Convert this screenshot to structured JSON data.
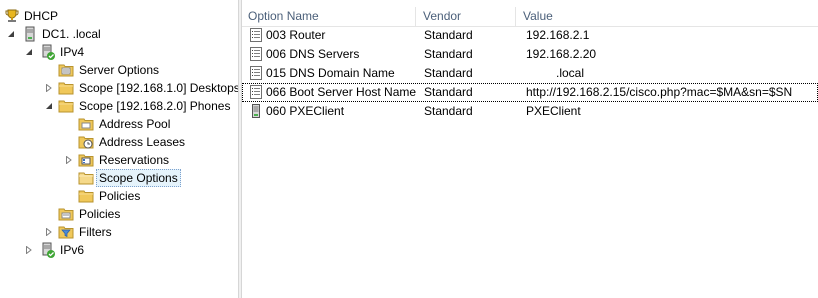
{
  "tree": {
    "root": {
      "label": "DHCP",
      "icon": "dhcp-icon"
    },
    "server": {
      "label": "DC1.        .local",
      "icon": "server-icon"
    },
    "ipv4": {
      "label": "IPv4",
      "icon": "ipv4-icon"
    },
    "server_options": {
      "label": "Server Options",
      "icon": "server-options-icon"
    },
    "scope1": {
      "label": "Scope [192.168.1.0] Desktops",
      "icon": "folder-icon"
    },
    "scope2": {
      "label": "Scope [192.168.2.0] Phones",
      "icon": "folder-icon"
    },
    "address_pool": {
      "label": "Address Pool",
      "icon": "address-pool-icon"
    },
    "address_leases": {
      "label": "Address Leases",
      "icon": "address-leases-icon"
    },
    "reservations": {
      "label": "Reservations",
      "icon": "reservations-icon"
    },
    "scope_options": {
      "label": "Scope Options",
      "icon": "scope-options-icon",
      "selected": true
    },
    "scope_policies": {
      "label": "Policies",
      "icon": "policies-icon"
    },
    "policies": {
      "label": "Policies",
      "icon": "policies-icon"
    },
    "filters": {
      "label": "Filters",
      "icon": "filter-icon"
    },
    "ipv6": {
      "label": "IPv6",
      "icon": "ipv6-icon"
    }
  },
  "list": {
    "columns": {
      "option_name": "Option Name",
      "vendor": "Vendor",
      "value": "Value"
    },
    "rows": [
      {
        "name": "003 Router",
        "vendor": "Standard",
        "value": "192.168.2.1",
        "icon": "option-icon"
      },
      {
        "name": "006 DNS Servers",
        "vendor": "Standard",
        "value": "192.168.2.20",
        "icon": "option-icon"
      },
      {
        "name": "015 DNS Domain Name",
        "vendor": "Standard",
        "value": "         .local",
        "icon": "option-icon"
      },
      {
        "name": "066 Boot Server Host Name",
        "vendor": "Standard",
        "value": "http://192.168.2.15/cisco.php?mac=$MA&sn=$SN",
        "icon": "option-icon",
        "focused": true
      },
      {
        "name": "060 PXEClient",
        "vendor": "Standard",
        "value": "PXEClient",
        "icon": "server-option-icon"
      }
    ]
  },
  "colors": {
    "selection_bg": "#e5f3fb",
    "folder": "#f0c85a",
    "header_text": "#4c607a"
  }
}
